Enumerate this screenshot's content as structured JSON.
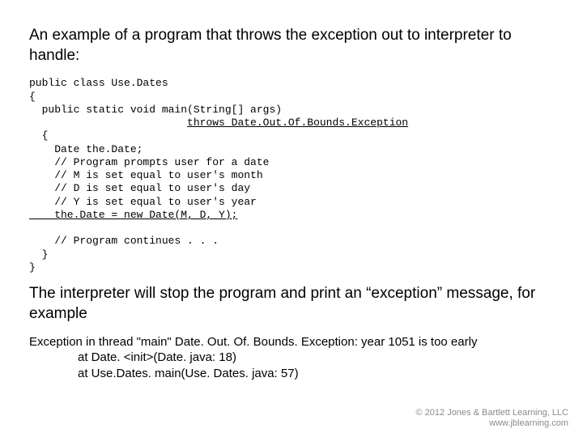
{
  "intro": "An example of a program that throws the exception out to interpreter to handle:",
  "code": {
    "l1": "public class Use.Dates",
    "l2": "{",
    "l3": "  public static void main(String[] args)",
    "l4a": "                         ",
    "l4b": "throws Date.Out.Of.Bounds.Exception",
    "l5": "  {",
    "l6": "    Date the.Date;",
    "l7": "    // Program prompts user for a date",
    "l8": "    // M is set equal to user's month",
    "l9": "    // D is set equal to user's day",
    "l10": "    // Y is set equal to user's year",
    "l11": "    the.Date = new Date(M, D, Y);",
    "l12": "",
    "l13": "    // Program continues . . .",
    "l14": "  }",
    "l15": "}"
  },
  "outro": "The interpreter will stop the program and print an “exception” message, for example",
  "trace": {
    "line1": "Exception in thread \"main\" Date. Out. Of. Bounds. Exception: year 1051 is too early",
    "at1": "at Date. <init>(Date. java: 18)",
    "at2": "at Use.Dates. main(Use. Dates. java: 57)"
  },
  "footer": {
    "copyright": "© 2012 Jones & Bartlett Learning, LLC",
    "url": "www.jblearning.com"
  }
}
